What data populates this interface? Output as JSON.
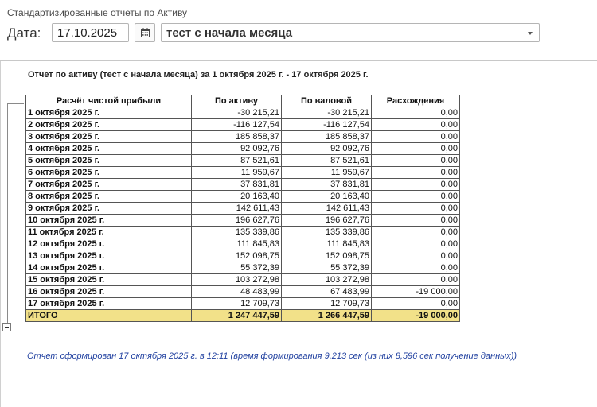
{
  "window": {
    "title": "Стандартизированные отчеты по Активу"
  },
  "params": {
    "date_label": "Дата:",
    "date_value": "17.10.2025",
    "period_value": "тест с начала месяца"
  },
  "report": {
    "title": "Отчет по активу (тест с начала месяца) за 1 октября 2025 г. - 17 октября 2025 г.",
    "headers": [
      "Расчёт чистой прибыли",
      "По активу",
      "По валовой",
      "Расхождения"
    ],
    "rows": [
      [
        "1 октября 2025 г.",
        "-30 215,21",
        "-30 215,21",
        "0,00"
      ],
      [
        "2 октября 2025 г.",
        "-116 127,54",
        "-116 127,54",
        "0,00"
      ],
      [
        "3 октября 2025 г.",
        "185 858,37",
        "185 858,37",
        "0,00"
      ],
      [
        "4 октября 2025 г.",
        "92 092,76",
        "92 092,76",
        "0,00"
      ],
      [
        "5 октября 2025 г.",
        "87 521,61",
        "87 521,61",
        "0,00"
      ],
      [
        "6 октября 2025 г.",
        "11 959,67",
        "11 959,67",
        "0,00"
      ],
      [
        "7 октября 2025 г.",
        "37 831,81",
        "37 831,81",
        "0,00"
      ],
      [
        "8 октября 2025 г.",
        "20 163,40",
        "20 163,40",
        "0,00"
      ],
      [
        "9 октября 2025 г.",
        "142 611,43",
        "142 611,43",
        "0,00"
      ],
      [
        "10 октября 2025 г.",
        "196 627,76",
        "196 627,76",
        "0,00"
      ],
      [
        "11 октября 2025 г.",
        "135 339,86",
        "135 339,86",
        "0,00"
      ],
      [
        "12 октября 2025 г.",
        "111 845,83",
        "111 845,83",
        "0,00"
      ],
      [
        "13 октября 2025 г.",
        "152 098,75",
        "152 098,75",
        "0,00"
      ],
      [
        "14 октября 2025 г.",
        "55 372,39",
        "55 372,39",
        "0,00"
      ],
      [
        "15 октября 2025 г.",
        "103 272,98",
        "103 272,98",
        "0,00"
      ],
      [
        "16 октября 2025 г.",
        "48 483,99",
        "67 483,99",
        "-19 000,00"
      ],
      [
        "17 октября 2025 г.",
        "12 709,73",
        "12 709,73",
        "0,00"
      ]
    ],
    "total": [
      "ИТОГО",
      "1 247 447,59",
      "1 266 447,59",
      "-19 000,00"
    ],
    "footer": "Отчет сформирован 17 октября 2025 г. в 12:11 (время формирования 9,213 сек (из них 8,596 сек получение данных))"
  },
  "colors": {
    "total_row": "#f2e189",
    "footer_text": "#1f3f9f"
  },
  "icons": {
    "calendar": "calendar-icon",
    "dropdown": "chevron-down-icon",
    "collapse": "minus-icon"
  }
}
